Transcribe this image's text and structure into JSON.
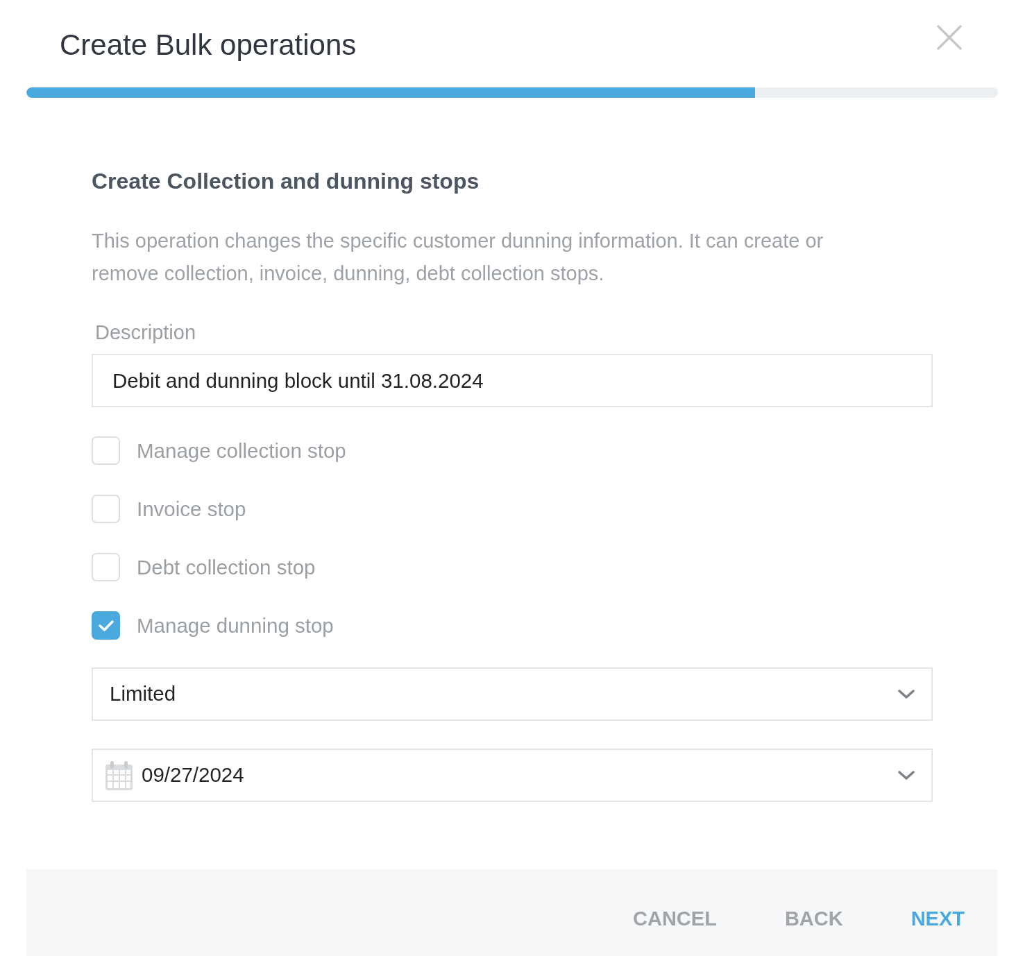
{
  "dialog": {
    "title": "Create Bulk operations",
    "progress": {
      "level": 0.75
    }
  },
  "section": {
    "heading": "Create Collection and dunning stops",
    "description": "This operation changes the specific customer dunning information. It can create or remove collection, invoice, dunning, debt collection stops."
  },
  "description_field": {
    "label": "Description",
    "value": "Debit and dunning block until 31.08.2024"
  },
  "options": [
    {
      "label": "Manage collection stop",
      "checked": false
    },
    {
      "label": "Invoice stop",
      "checked": false
    },
    {
      "label": "Debt collection stop",
      "checked": false
    },
    {
      "label": "Manage dunning stop",
      "checked": true
    }
  ],
  "dunning_type": {
    "value": "Limited"
  },
  "date_field": {
    "value": "09/27/2024"
  },
  "buttons": [
    {
      "label": "CANCEL",
      "kind": "secondary"
    },
    {
      "label": "BACK",
      "kind": "secondary"
    },
    {
      "label": "NEXT",
      "kind": "primary"
    }
  ]
}
